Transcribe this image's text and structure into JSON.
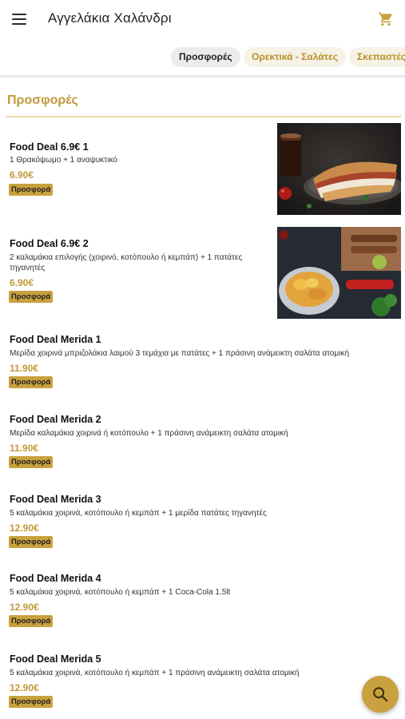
{
  "appbar": {
    "title": "Αγγελάκια Χαλάνδρι",
    "menu_icon": "menu-icon",
    "cart_icon": "cart-icon"
  },
  "tabs": [
    {
      "label": "Προσφορές",
      "active": true
    },
    {
      "label": "Ορεκτικά - Σαλάτες",
      "active": false
    },
    {
      "label": "Σκεπαστές -",
      "active": false
    }
  ],
  "section": {
    "title": "Προσφορές"
  },
  "items": [
    {
      "name": "Food Deal 6.9€ 1",
      "description": "1 Θρακόψωμο + 1 αναψυκτικό",
      "price": "6.90€",
      "badge": "Προσφορά",
      "image": "sandwich-photo"
    },
    {
      "name": "Food Deal 6.9€ 2",
      "description": "2 καλαμάκια επιλογής (χοιρινό, κοτόπουλο ή κεμπάπ) + 1 πατάτες τηγανητές",
      "price": "6.90€",
      "badge": "Προσφορά",
      "image": "skewers-fries-photo"
    },
    {
      "name": "Food Deal Merida 1",
      "description": "Μερίδα χοιρινά μπριζολάκια λαιμού 3 τεμάχια με πατάτες + 1 πράσινη ανάμεικτη σαλάτα ατομική",
      "price": "11.90€",
      "badge": "Προσφορά"
    },
    {
      "name": "Food Deal Merida 2",
      "description": "Μερίδα καλαμάκια χοιρινά ή κοτόπουλο + 1 πράσινη ανάμεικτη σαλάτα ατομική",
      "price": "11.90€",
      "badge": "Προσφορά"
    },
    {
      "name": "Food Deal Merida 3",
      "description": "5 καλαμάκια χοιρινά, κοτόπουλο ή κεμπάπ + 1 μερίδα πατάτες τηγανητές",
      "price": "12.90€",
      "badge": "Προσφορά"
    },
    {
      "name": "Food Deal Merida 4",
      "description": "5 καλαμάκια χοιρινά, κοτόπουλο ή κεμπάπ + 1 Coca-Cola 1.5lt",
      "price": "12.90€",
      "badge": "Προσφορά"
    },
    {
      "name": "Food Deal Merida 5",
      "description": "5 καλαμάκια χοιρινά, κοτόπουλο ή κεμπάπ + 1 πράσινη ανάμεικτη σαλάτα ατομική",
      "price": "12.90€",
      "badge": "Προσφορά"
    }
  ],
  "fab": {
    "icon": "search-icon"
  },
  "colors": {
    "accent": "#c09a38",
    "badge": "#c9a13e",
    "rule": "#ead9ad"
  }
}
